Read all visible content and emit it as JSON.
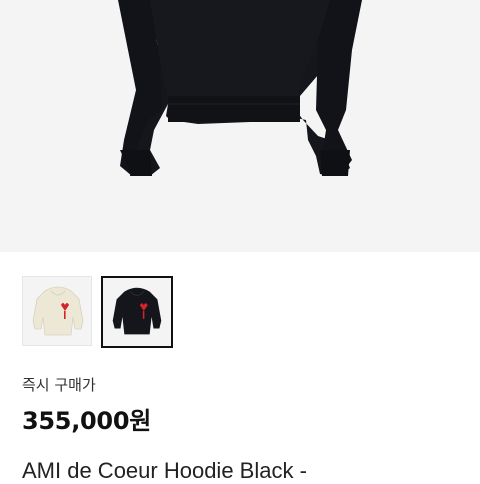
{
  "product": {
    "purchase_label": "즉시 구매가",
    "price": "355,000원",
    "title": "AMI de Coeur Hoodie Black -"
  },
  "gallery": {
    "thumbnails": [
      {
        "alt": "ivory hoodie",
        "color": "#ede8d6",
        "selected": false
      },
      {
        "alt": "black hoodie",
        "color": "#15161c",
        "selected": true
      }
    ]
  },
  "colors": {
    "background": "#f4f4f4",
    "hoodie_black": "#15161c",
    "hoodie_ivory": "#ede8d6",
    "logo_red": "#d4232b"
  }
}
